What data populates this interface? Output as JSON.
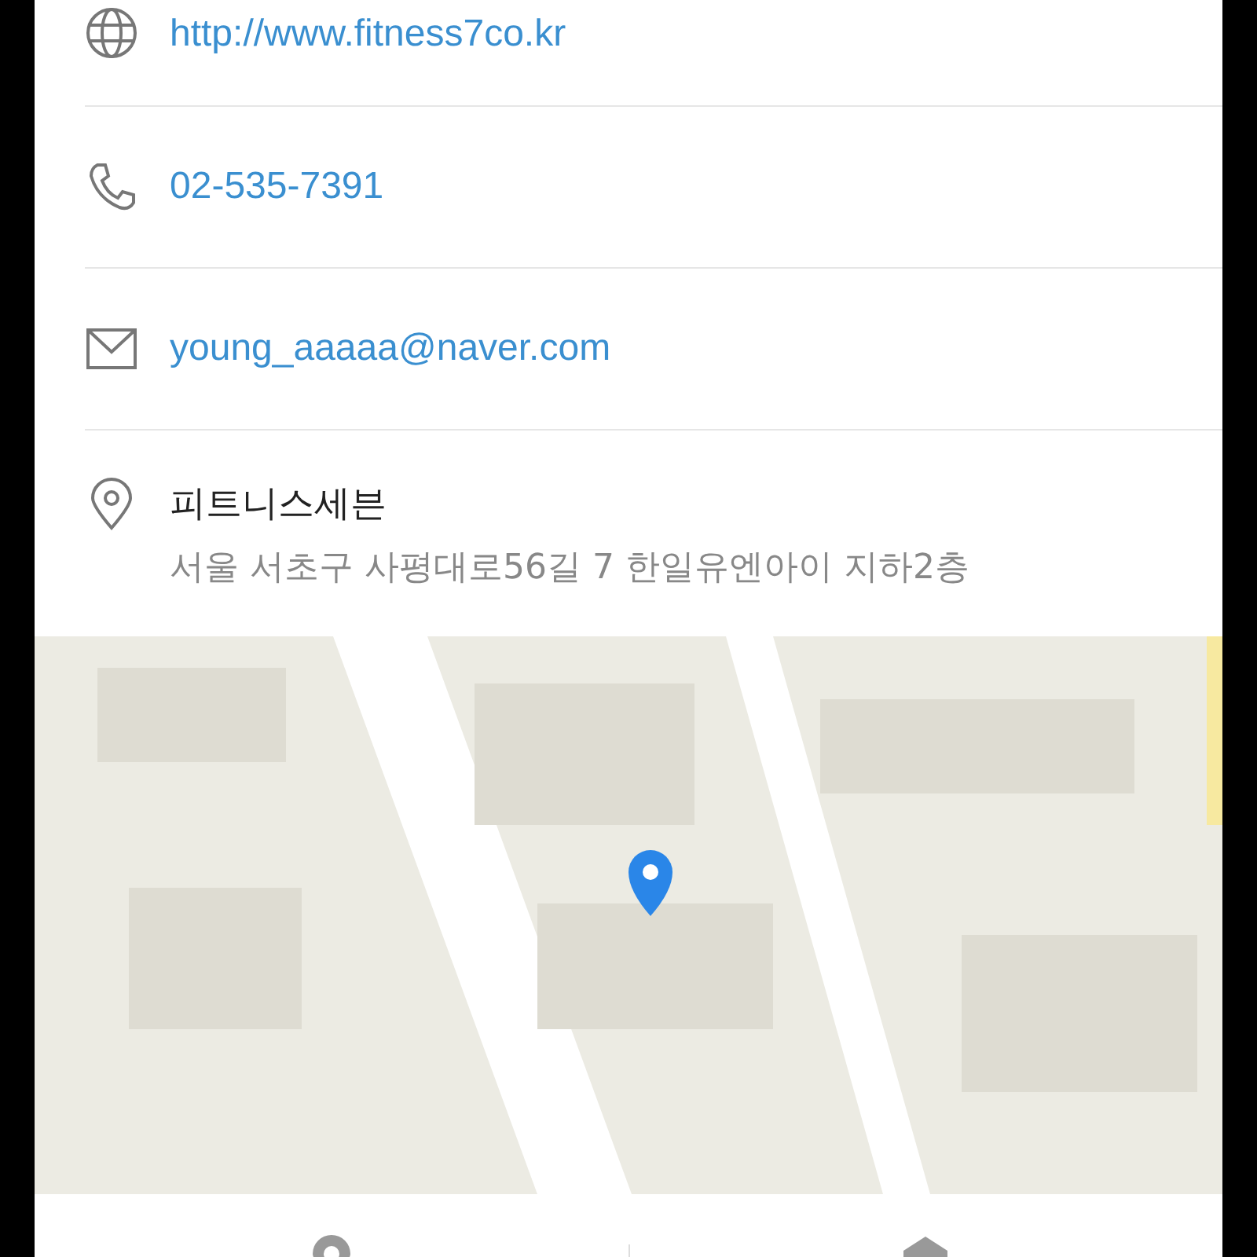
{
  "contacts": [
    {
      "kind": "web",
      "text": "http://www.fitness7co.kr"
    },
    {
      "kind": "phone",
      "text": "02-535-7391"
    },
    {
      "kind": "email",
      "text": "young_aaaaa@naver.com"
    }
  ],
  "place": {
    "name": "피트니스세븐",
    "address": "서울 서초구 사평대로56길 7 한일유엔아이 지하2층"
  },
  "bottom_actions": [
    {
      "kind": "pin"
    },
    {
      "kind": "navigate"
    }
  ]
}
